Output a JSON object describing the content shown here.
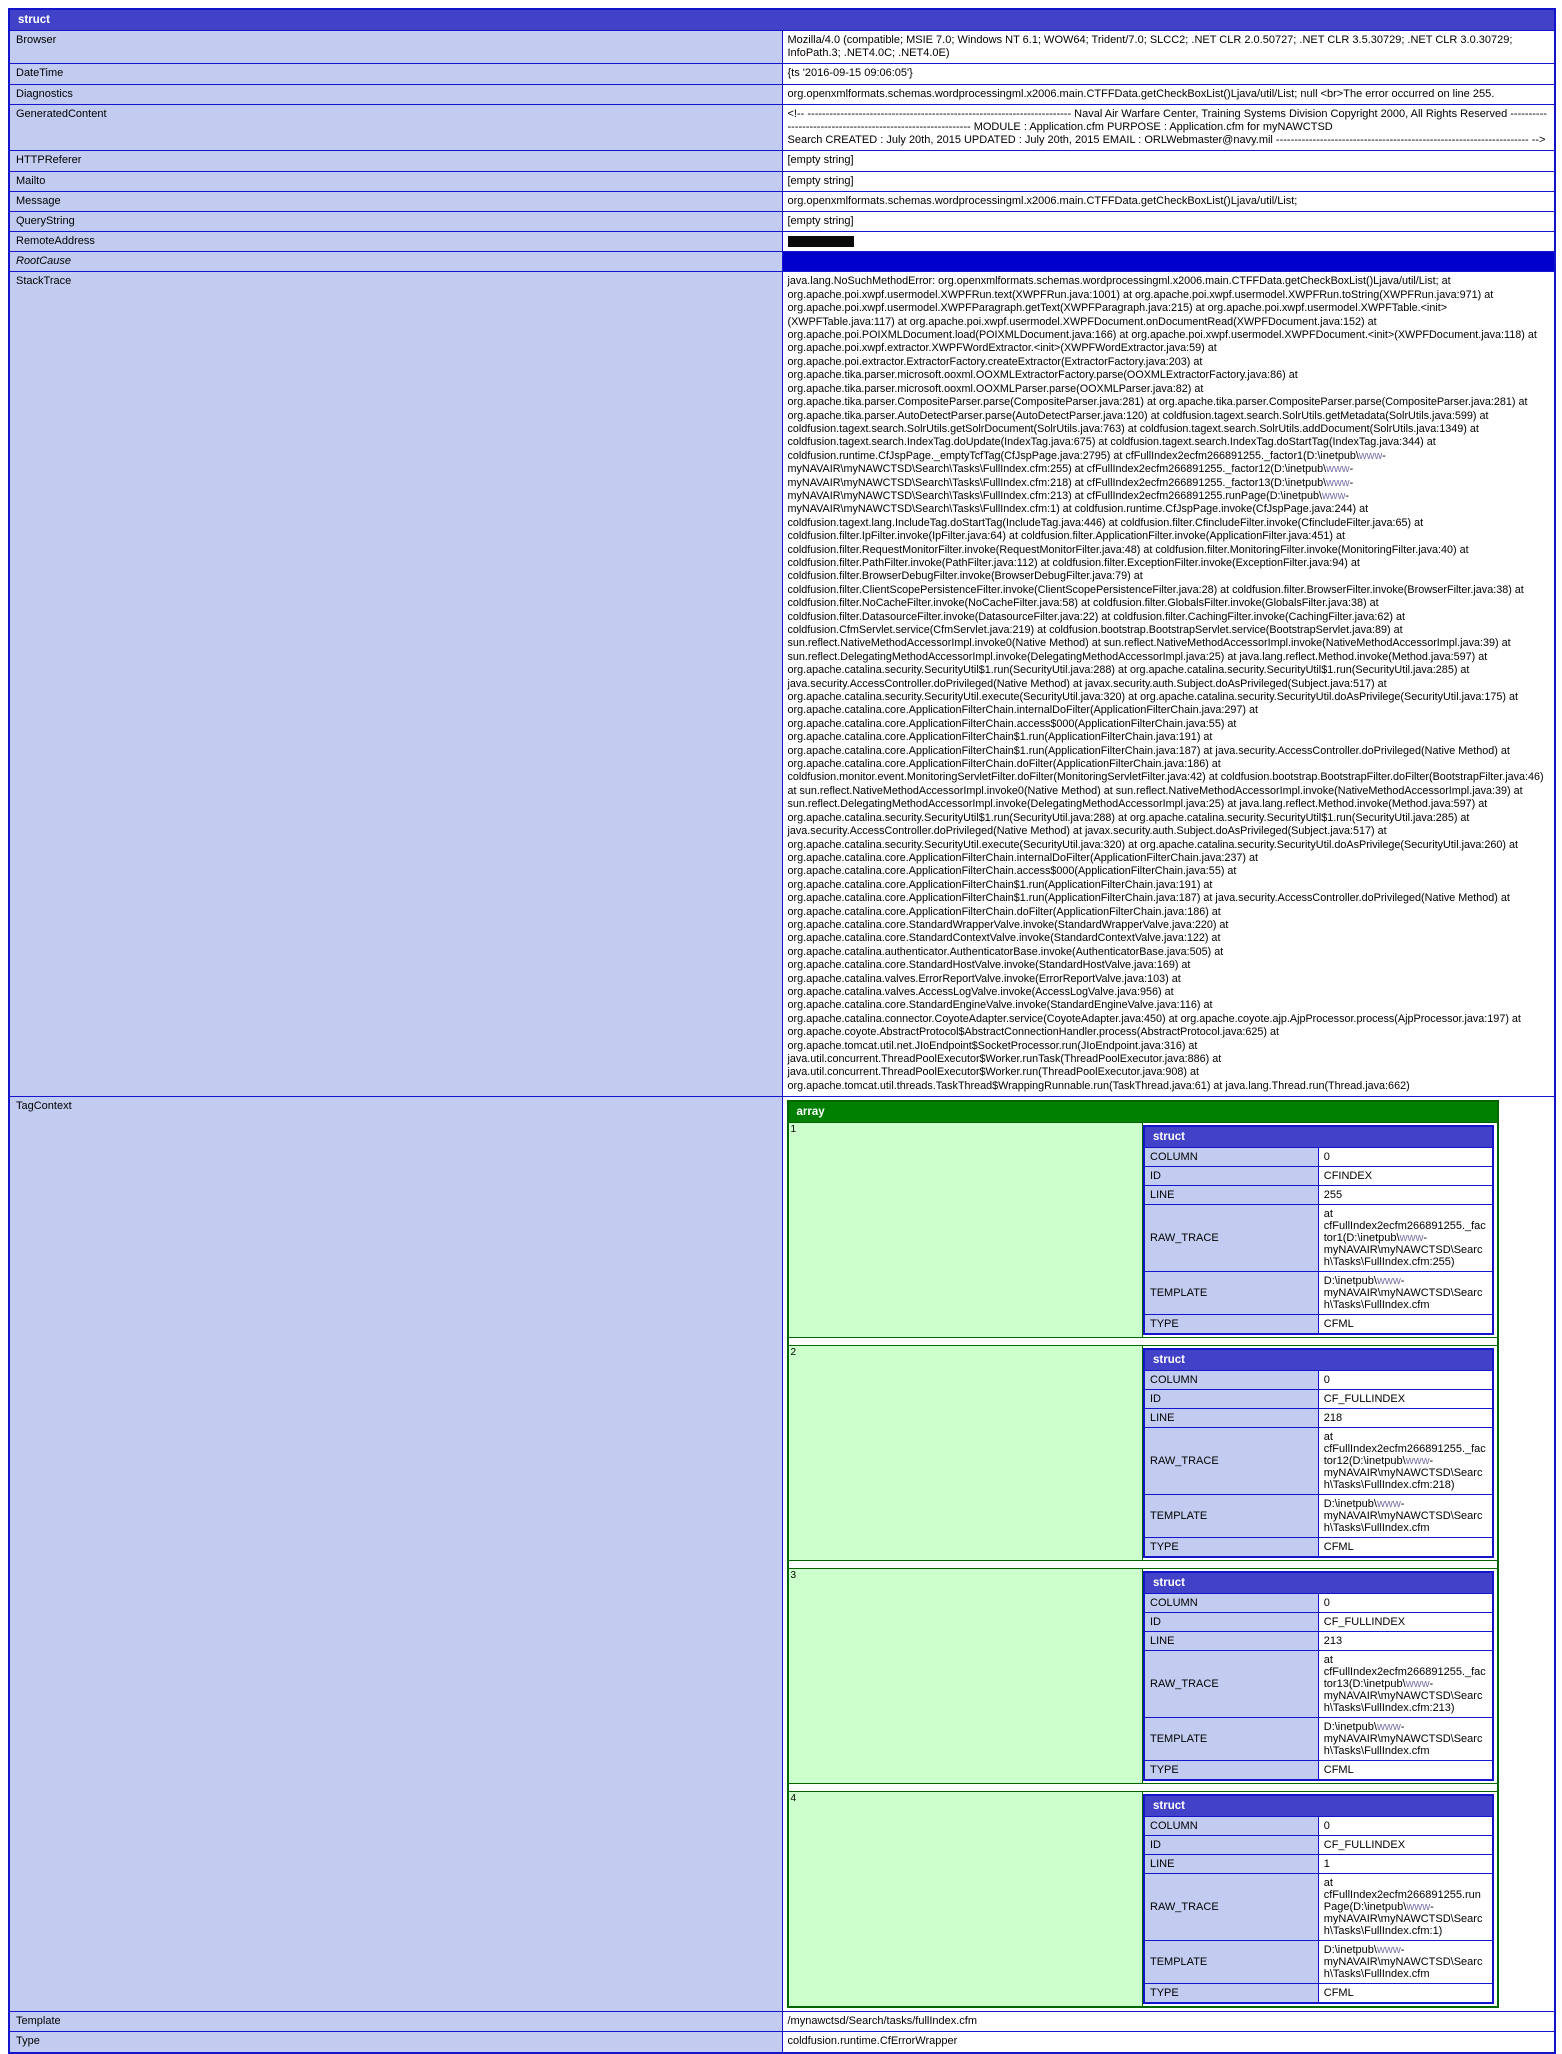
{
  "colors": {
    "struct_header_bg": "#4242C8",
    "array_header_bg": "#008000",
    "label_bg": "#C2CCF0",
    "index_bg": "#CCFFCC",
    "border_blue": "#1414CC",
    "rootcause_bg": "#0000CC",
    "path_accent": "#7A6FA8"
  },
  "root": {
    "header": "struct",
    "rows": {
      "browser": {
        "label": "Browser",
        "value": "Mozilla/4.0 (compatible; MSIE 7.0; Windows NT 6.1; WOW64; Trident/7.0; SLCC2; .NET CLR 2.0.50727; .NET CLR 3.5.30729; .NET CLR 3.0.30729; InfoPath.3; .NET4.0C; .NET4.0E)"
      },
      "datetime": {
        "label": "DateTime",
        "value": "{ts '2016-09-15 09:06:05'}"
      },
      "diagnostics": {
        "label": "Diagnostics",
        "value": "org.openxmlformats.schemas.wordprocessingml.x2006.main.CTFFData.getCheckBoxList()Ljava/util/List; null <br>The error occurred on line 255."
      },
      "generatedcontent": {
        "label": "GeneratedContent",
        "line1": "<!-- ------------------------------------------------------------------------ Naval Air Warfare Center, Training Systems Division Copyright 2000, All Rights Reserved ------------------------------------------------------------ MODULE : Application.cfm PURPOSE : Application.cfm for myNAWCTSD",
        "line2": "Search CREATED : July 20th, 2015 UPDATED : July 20th, 2015 EMAIL : ORLWebmaster@navy.mil --------------------------------------------------------------------- -->"
      },
      "httpreferer": {
        "label": "HTTPReferer",
        "value": "[empty string]"
      },
      "mailto": {
        "label": "Mailto",
        "value": "[empty string]"
      },
      "message": {
        "label": "Message",
        "value": "org.openxmlformats.schemas.wordprocessingml.x2006.main.CTFFData.getCheckBoxList()Ljava/util/List;"
      },
      "querystring": {
        "label": "QueryString",
        "value": "[empty string]"
      },
      "remoteaddress": {
        "label": "RemoteAddress",
        "value": "",
        "redacted": true
      },
      "rootcause": {
        "label": "RootCause",
        "value": ""
      },
      "stacktrace": {
        "label": "StackTrace"
      },
      "tagcontext": {
        "label": "TagContext"
      },
      "template": {
        "label": "Template",
        "value": "/mynawctsd/Search/tasks/fullIndex.cfm"
      },
      "type": {
        "label": "Type",
        "value": "coldfusion.runtime.CfErrorWrapper"
      }
    }
  },
  "stacktrace_text": "java.lang.NoSuchMethodError: org.openxmlformats.schemas.wordprocessingml.x2006.main.CTFFData.getCheckBoxList()Ljava/util/List; at org.apache.poi.xwpf.usermodel.XWPFRun.text(XWPFRun.java:1001) at org.apache.poi.xwpf.usermodel.XWPFRun.toString(XWPFRun.java:971) at org.apache.poi.xwpf.usermodel.XWPFParagraph.getText(XWPFParagraph.java:215) at org.apache.poi.xwpf.usermodel.XWPFTable.<init>(XWPFTable.java:117) at org.apache.poi.xwpf.usermodel.XWPFDocument.onDocumentRead(XWPFDocument.java:152) at org.apache.poi.POIXMLDocument.load(POIXMLDocument.java:166) at org.apache.poi.xwpf.usermodel.XWPFDocument.<init>(XWPFDocument.java:118) at org.apache.poi.xwpf.extractor.XWPFWordExtractor.<init>(XWPFWordExtractor.java:59) at org.apache.poi.extractor.ExtractorFactory.createExtractor(ExtractorFactory.java:203) at org.apache.tika.parser.microsoft.ooxml.OOXMLExtractorFactory.parse(OOXMLExtractorFactory.java:86) at org.apache.tika.parser.microsoft.ooxml.OOXMLParser.parse(OOXMLParser.java:82) at org.apache.tika.parser.CompositeParser.parse(CompositeParser.java:281) at org.apache.tika.parser.CompositeParser.parse(CompositeParser.java:281) at org.apache.tika.parser.AutoDetectParser.parse(AutoDetectParser.java:120) at coldfusion.tagext.search.SolrUtils.getMetadata(SolrUtils.java:599) at coldfusion.tagext.search.SolrUtils.getSolrDocument(SolrUtils.java:763) at coldfusion.tagext.search.SolrUtils.addDocument(SolrUtils.java:1349) at coldfusion.tagext.search.IndexTag.doUpdate(IndexTag.java:675) at coldfusion.tagext.search.IndexTag.doStartTag(IndexTag.java:344) at coldfusion.runtime.CfJspPage._emptyTcfTag(CfJspPage.java:2795) at cfFullIndex2ecfm266891255._factor1(D:\\inetpub\\www-myNAVAIR\\myNAWCTSD\\Search\\Tasks\\FullIndex.cfm:255) at cfFullIndex2ecfm266891255._factor12(D:\\inetpub\\www-myNAVAIR\\myNAWCTSD\\Search\\Tasks\\FullIndex.cfm:218) at cfFullIndex2ecfm266891255._factor13(D:\\inetpub\\www-myNAVAIR\\myNAWCTSD\\Search\\Tasks\\FullIndex.cfm:213) at cfFullIndex2ecfm266891255.runPage(D:\\inetpub\\www-myNAVAIR\\myNAWCTSD\\Search\\Tasks\\FullIndex.cfm:1) at coldfusion.runtime.CfJspPage.invoke(CfJspPage.java:244) at coldfusion.tagext.lang.IncludeTag.doStartTag(IncludeTag.java:446) at coldfusion.filter.CfincludeFilter.invoke(CfincludeFilter.java:65) at coldfusion.filter.IpFilter.invoke(IpFilter.java:64) at coldfusion.filter.ApplicationFilter.invoke(ApplicationFilter.java:451) at coldfusion.filter.RequestMonitorFilter.invoke(RequestMonitorFilter.java:48) at coldfusion.filter.MonitoringFilter.invoke(MonitoringFilter.java:40) at coldfusion.filter.PathFilter.invoke(PathFilter.java:112) at coldfusion.filter.ExceptionFilter.invoke(ExceptionFilter.java:94) at coldfusion.filter.BrowserDebugFilter.invoke(BrowserDebugFilter.java:79) at coldfusion.filter.ClientScopePersistenceFilter.invoke(ClientScopePersistenceFilter.java:28) at coldfusion.filter.BrowserFilter.invoke(BrowserFilter.java:38) at coldfusion.filter.NoCacheFilter.invoke(NoCacheFilter.java:58) at coldfusion.filter.GlobalsFilter.invoke(GlobalsFilter.java:38) at coldfusion.filter.DatasourceFilter.invoke(DatasourceFilter.java:22) at coldfusion.filter.CachingFilter.invoke(CachingFilter.java:62) at coldfusion.CfmServlet.service(CfmServlet.java:219) at coldfusion.bootstrap.BootstrapServlet.service(BootstrapServlet.java:89) at sun.reflect.NativeMethodAccessorImpl.invoke0(Native Method) at sun.reflect.NativeMethodAccessorImpl.invoke(NativeMethodAccessorImpl.java:39) at sun.reflect.DelegatingMethodAccessorImpl.invoke(DelegatingMethodAccessorImpl.java:25) at java.lang.reflect.Method.invoke(Method.java:597) at org.apache.catalina.security.SecurityUtil$1.run(SecurityUtil.java:288) at org.apache.catalina.security.SecurityUtil$1.run(SecurityUtil.java:285) at java.security.AccessController.doPrivileged(Native Method) at javax.security.auth.Subject.doAsPrivileged(Subject.java:517) at org.apache.catalina.security.SecurityUtil.execute(SecurityUtil.java:320) at org.apache.catalina.security.SecurityUtil.doAsPrivilege(SecurityUtil.java:175) at org.apache.catalina.core.ApplicationFilterChain.internalDoFilter(ApplicationFilterChain.java:297) at org.apache.catalina.core.ApplicationFilterChain.access$000(ApplicationFilterChain.java:55) at org.apache.catalina.core.ApplicationFilterChain$1.run(ApplicationFilterChain.java:191) at org.apache.catalina.core.ApplicationFilterChain$1.run(ApplicationFilterChain.java:187) at java.security.AccessController.doPrivileged(Native Method) at org.apache.catalina.core.ApplicationFilterChain.doFilter(ApplicationFilterChain.java:186) at coldfusion.monitor.event.MonitoringServletFilter.doFilter(MonitoringServletFilter.java:42) at coldfusion.bootstrap.BootstrapFilter.doFilter(BootstrapFilter.java:46) at sun.reflect.NativeMethodAccessorImpl.invoke0(Native Method) at sun.reflect.NativeMethodAccessorImpl.invoke(NativeMethodAccessorImpl.java:39) at sun.reflect.DelegatingMethodAccessorImpl.invoke(DelegatingMethodAccessorImpl.java:25) at java.lang.reflect.Method.invoke(Method.java:597) at org.apache.catalina.security.SecurityUtil$1.run(SecurityUtil.java:288) at org.apache.catalina.security.SecurityUtil$1.run(SecurityUtil.java:285) at java.security.AccessController.doPrivileged(Native Method) at javax.security.auth.Subject.doAsPrivileged(Subject.java:517) at org.apache.catalina.security.SecurityUtil.execute(SecurityUtil.java:320) at org.apache.catalina.security.SecurityUtil.doAsPrivilege(SecurityUtil.java:260) at org.apache.catalina.core.ApplicationFilterChain.internalDoFilter(ApplicationFilterChain.java:237) at org.apache.catalina.core.ApplicationFilterChain.access$000(ApplicationFilterChain.java:55) at org.apache.catalina.core.ApplicationFilterChain$1.run(ApplicationFilterChain.java:191) at org.apache.catalina.core.ApplicationFilterChain$1.run(ApplicationFilterChain.java:187) at java.security.AccessController.doPrivileged(Native Method) at org.apache.catalina.core.ApplicationFilterChain.doFilter(ApplicationFilterChain.java:186) at org.apache.catalina.core.StandardWrapperValve.invoke(StandardWrapperValve.java:220) at org.apache.catalina.core.StandardContextValve.invoke(StandardContextValve.java:122) at org.apache.catalina.authenticator.AuthenticatorBase.invoke(AuthenticatorBase.java:505) at org.apache.catalina.core.StandardHostValve.invoke(StandardHostValve.java:169) at org.apache.catalina.valves.ErrorReportValve.invoke(ErrorReportValve.java:103) at org.apache.catalina.valves.AccessLogValve.invoke(AccessLogValve.java:956) at org.apache.catalina.core.StandardEngineValve.invoke(StandardEngineValve.java:116) at org.apache.catalina.connector.CoyoteAdapter.service(CoyoteAdapter.java:450) at org.apache.coyote.ajp.AjpProcessor.process(AjpProcessor.java:197) at org.apache.coyote.AbstractProtocol$AbstractConnectionHandler.process(AbstractProtocol.java:625) at org.apache.tomcat.util.net.JIoEndpoint$SocketProcessor.run(JIoEndpoint.java:316) at java.util.concurrent.ThreadPoolExecutor$Worker.runTask(ThreadPoolExecutor.java:886) at java.util.concurrent.ThreadPoolExecutor$Worker.run(ThreadPoolExecutor.java:908) at org.apache.tomcat.util.threads.TaskThread$WrappingRunnable.run(TaskThread.java:61) at java.lang.Thread.run(Thread.java:662)",
  "tagcontext": {
    "array_header": "array",
    "struct_header": "struct",
    "field_labels": {
      "column": "COLUMN",
      "id": "ID",
      "line": "LINE",
      "raw_trace": "RAW_TRACE",
      "template": "TEMPLATE",
      "type": "TYPE"
    },
    "items": [
      {
        "index": "1",
        "COLUMN": "0",
        "ID": "CFINDEX",
        "LINE": "255",
        "RAW_TRACE": "at cfFullIndex2ecfm266891255._factor1(D:\\inetpub\\www-myNAVAIR\\myNAWCTSD\\Search\\Tasks\\FullIndex.cfm:255)",
        "TEMPLATE": "D:\\inetpub\\www-myNAVAIR\\myNAWCTSD\\Search\\Tasks\\FullIndex.cfm",
        "TYPE": "CFML"
      },
      {
        "index": "2",
        "COLUMN": "0",
        "ID": "CF_FULLINDEX",
        "LINE": "218",
        "RAW_TRACE": "at cfFullIndex2ecfm266891255._factor12(D:\\inetpub\\www-myNAVAIR\\myNAWCTSD\\Search\\Tasks\\FullIndex.cfm:218)",
        "TEMPLATE": "D:\\inetpub\\www-myNAVAIR\\myNAWCTSD\\Search\\Tasks\\FullIndex.cfm",
        "TYPE": "CFML"
      },
      {
        "index": "3",
        "COLUMN": "0",
        "ID": "CF_FULLINDEX",
        "LINE": "213",
        "RAW_TRACE": "at cfFullIndex2ecfm266891255._factor13(D:\\inetpub\\www-myNAVAIR\\myNAWCTSD\\Search\\Tasks\\FullIndex.cfm:213)",
        "TEMPLATE": "D:\\inetpub\\www-myNAVAIR\\myNAWCTSD\\Search\\Tasks\\FullIndex.cfm",
        "TYPE": "CFML"
      },
      {
        "index": "4",
        "COLUMN": "0",
        "ID": "CF_FULLINDEX",
        "LINE": "1",
        "RAW_TRACE": "at cfFullIndex2ecfm266891255.runPage(D:\\inetpub\\www-myNAVAIR\\myNAWCTSD\\Search\\Tasks\\FullIndex.cfm:1)",
        "TEMPLATE": "D:\\inetpub\\www-myNAVAIR\\myNAWCTSD\\Search\\Tasks\\FullIndex.cfm",
        "TYPE": "CFML"
      }
    ]
  }
}
